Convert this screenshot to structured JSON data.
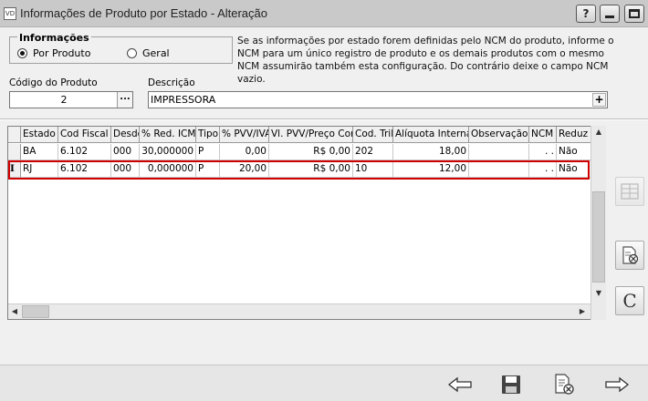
{
  "window": {
    "app_icon": "VD",
    "title": "Informações de Produto por Estado - Alteração",
    "help_glyph": "?"
  },
  "info_group": {
    "title": "Informações",
    "options": [
      {
        "label": "Por Produto",
        "selected": true
      },
      {
        "label": "Geral",
        "selected": false
      }
    ],
    "note": "Se as informações por estado forem definidas pelo NCM do produto, informe o NCM para um único registro de produto e os demais produtos com o mesmo NCM assumirão também esta configuração. Do contrário deixe o campo NCM vazio."
  },
  "fields": {
    "codigo_label": "Código do Produto",
    "codigo_value": "2",
    "codigo_button": "...",
    "descricao_label": "Descrição",
    "descricao_value": "IMPRESSORA",
    "descricao_button": "+"
  },
  "grid": {
    "columns": [
      "Estado",
      "Cod Fiscal",
      "Desdo",
      "% Red. ICM",
      "Tipo",
      "% PVV/IVA",
      "Vl. PVV/Preço Cons",
      "Cod. Trib",
      "Alíquota Interna",
      "Observação",
      "NCM",
      "Reduz"
    ],
    "rows": [
      {
        "indicator": "",
        "cells": [
          "BA",
          "6.102",
          "000",
          "30,000000",
          "P",
          "0,00",
          "R$ 0,00",
          "202",
          "18,00",
          "",
          ". .",
          "Não"
        ]
      },
      {
        "indicator": "I",
        "cells": [
          "RJ",
          "6.102",
          "000",
          "0,000000",
          "P",
          "20,00",
          "R$ 0,00",
          "10",
          "12,00",
          "",
          ". .",
          "Não"
        ]
      }
    ],
    "selected_row": 1
  },
  "side_buttons": [
    "grid-icon",
    "delete-record-icon",
    "c-letter-icon"
  ],
  "side_letter": "C",
  "toolbar": [
    "back-arrow-icon",
    "save-icon",
    "cancel-document-icon",
    "forward-arrow-icon"
  ],
  "colors": {
    "highlight": "#d10000",
    "titlebar": "#c9c9c9",
    "background": "#f0f0f0"
  }
}
